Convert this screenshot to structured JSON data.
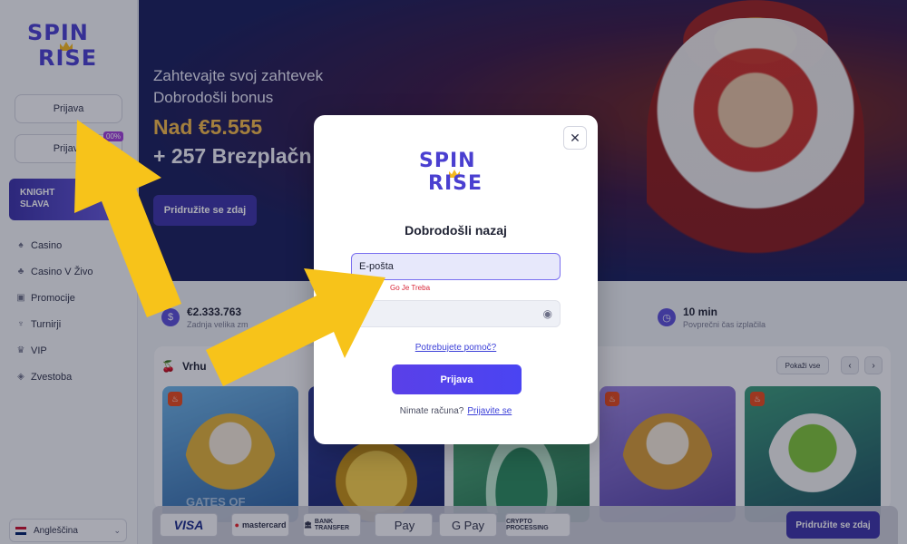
{
  "brand": {
    "line1": "SPIN",
    "line2": "RISE"
  },
  "sidebar": {
    "login_label": "Prijava",
    "register_label": "Prijava",
    "promo_tag": "00%",
    "knight_line1": "KNIGHT",
    "knight_line2": "SLAVA",
    "nav": [
      {
        "label": "Casino",
        "icon": "spade-icon"
      },
      {
        "label": "Casino V Živo",
        "icon": "club-icon"
      },
      {
        "label": "Promocije",
        "icon": "gift-icon"
      },
      {
        "label": "Turnirji",
        "icon": "trophy-icon"
      },
      {
        "label": "VIP",
        "icon": "crown-icon"
      },
      {
        "label": "Zvestoba",
        "icon": "shield-icon"
      }
    ],
    "language": "Angleščina"
  },
  "hero": {
    "line1": "Zahtevajte svoj zahtevek",
    "line2": "Dobrodošli bonus",
    "amount": "Nad €5.555",
    "free_spins": "+ 257 Brezplačn",
    "cta": "Pridružite se zdaj"
  },
  "stats": [
    {
      "value": "€2.333.763",
      "label": "Zadnja velika zm"
    },
    {
      "value": "10 min",
      "label": "Povprečni čas izplačila"
    }
  ],
  "games": {
    "title": "Vrhu",
    "show_all": "Pokaži vse",
    "prev": "‹",
    "next": "›",
    "card_caption": "GATES OF"
  },
  "payments": [
    "VISA",
    "mastercard",
    "BANK TRANSFER",
    "Pay",
    "G Pay",
    "CRYPTO PROCESSING"
  ],
  "footer_cta": "Pridružite se zdaj",
  "modal": {
    "close": "✕",
    "title": "Dobrodošli nazaj",
    "email_value": "E-pošta",
    "error_text": "Go Je Treba",
    "password_placeholder": "lo",
    "help_link": "Potrebujete pomoč?",
    "login_button": "Prijava",
    "no_account": "Nimate računa?",
    "register_link": "Prijavite se"
  },
  "colors": {
    "accent": "#4a3fd0",
    "button": "#3d33a8",
    "arrow": "#f7c31a",
    "error": "#d8283a"
  }
}
